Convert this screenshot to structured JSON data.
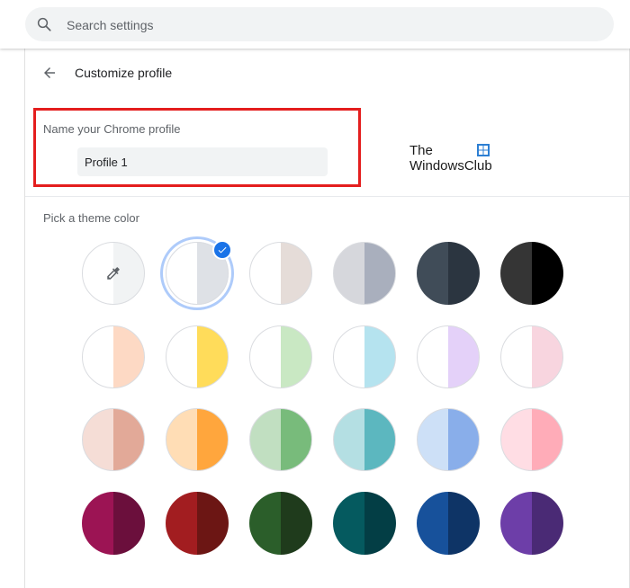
{
  "search": {
    "placeholder": "Search settings",
    "icon": "search-icon"
  },
  "header": {
    "title": "Customize profile",
    "back_icon": "arrow-left-icon"
  },
  "name_section": {
    "label": "Name your Chrome profile",
    "value": "Profile 1"
  },
  "watermark": {
    "line1": "The",
    "line2": "WindowsClub"
  },
  "theme": {
    "label": "Pick a theme color",
    "selected_index": 1,
    "swatches": [
      {
        "left": "#ffffff",
        "right": "#f1f3f4",
        "outlined": true,
        "picker": true
      },
      {
        "left": "#ffffff",
        "right": "#dee1e6",
        "outlined": true
      },
      {
        "left": "#ffffff",
        "right": "#e5dcd8",
        "outlined": true
      },
      {
        "left": "#d6d7dc",
        "right": "#a9afbd",
        "outlined": true
      },
      {
        "left": "#404c58",
        "right": "#2b3540",
        "outlined": false
      },
      {
        "left": "#353535",
        "right": "#000000",
        "outlined": false
      },
      {
        "left": "#ffffff",
        "right": "#fdd9c4",
        "outlined": true
      },
      {
        "left": "#ffffff",
        "right": "#ffdc5a",
        "outlined": true
      },
      {
        "left": "#ffffff",
        "right": "#c9e8c3",
        "outlined": true
      },
      {
        "left": "#ffffff",
        "right": "#b5e3ef",
        "outlined": true
      },
      {
        "left": "#ffffff",
        "right": "#e4d1f9",
        "outlined": true
      },
      {
        "left": "#ffffff",
        "right": "#f8d5df",
        "outlined": true
      },
      {
        "left": "#f5ddd6",
        "right": "#e2a998",
        "outlined": true
      },
      {
        "left": "#ffddb5",
        "right": "#ffa63d",
        "outlined": true
      },
      {
        "left": "#c1dfc1",
        "right": "#78bb7b",
        "outlined": true
      },
      {
        "left": "#b4dfe3",
        "right": "#5cb7bf",
        "outlined": true
      },
      {
        "left": "#cde0f7",
        "right": "#89aeea",
        "outlined": true
      },
      {
        "left": "#ffdde4",
        "right": "#ffacb8",
        "outlined": true
      },
      {
        "left": "#9c1454",
        "right": "#6b0f3c",
        "outlined": false
      },
      {
        "left": "#a21d20",
        "right": "#6c1614",
        "outlined": false
      },
      {
        "left": "#2b5e2a",
        "right": "#1f3b1c",
        "outlined": false
      },
      {
        "left": "#055a5f",
        "right": "#033e45",
        "outlined": false
      },
      {
        "left": "#17519b",
        "right": "#0e3466",
        "outlined": false
      },
      {
        "left": "#6d3ea8",
        "right": "#4a2a75",
        "outlined": false
      }
    ]
  }
}
